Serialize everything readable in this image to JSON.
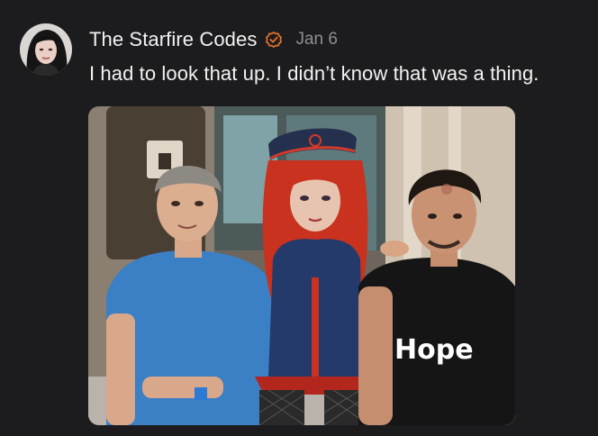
{
  "post": {
    "author": "The Starfire Codes",
    "date": "Jan 6",
    "text": "I had to look that up. I didn’t know that was a thing.",
    "verified_icon": "verified-check-icon",
    "accent_color": "#e8732a"
  },
  "media": {
    "shirt_text": "Hope"
  }
}
